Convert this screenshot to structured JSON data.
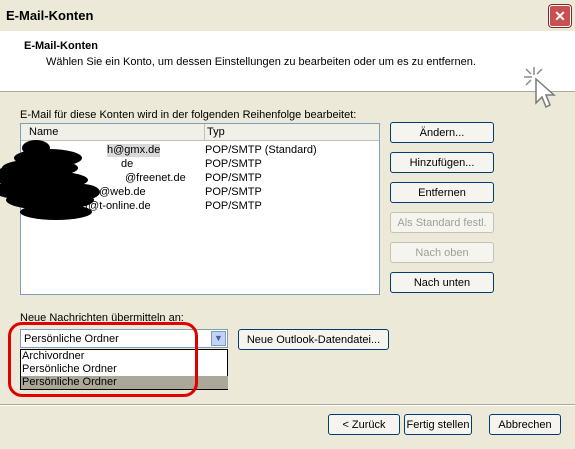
{
  "window": {
    "title": "E-Mail-Konten",
    "close_label": "✕"
  },
  "header": {
    "title": "E-Mail-Konten",
    "subtitle": "Wählen Sie ein Konto, um dessen Einstellungen zu bearbeiten oder um es zu entfernen."
  },
  "list_label": "E-Mail für diese Konten wird in der folgenden Reihenfolge bearbeitet:",
  "columns": {
    "name": "Name",
    "type": "Typ"
  },
  "accounts": [
    {
      "name": "h@gmx.de",
      "type": "POP/SMTP (Standard)"
    },
    {
      "name": "de",
      "type": "POP/SMTP"
    },
    {
      "name": "@freenet.de",
      "type": "POP/SMTP"
    },
    {
      "name": "@web.de",
      "type": "POP/SMTP"
    },
    {
      "name": "t@t-online.de",
      "type": "POP/SMTP"
    }
  ],
  "buttons": {
    "change": "Ändern...",
    "add": "Hinzufügen...",
    "remove": "Entfernen",
    "set_default": "Als Standard festl.",
    "move_up": "Nach oben",
    "move_down": "Nach unten",
    "new_data_file": "Neue Outlook-Datendatei...",
    "back": "< Zurück",
    "finish": "Fertig stellen",
    "cancel": "Abbrechen"
  },
  "delivery": {
    "label": "Neue Nachrichten übermitteln an:",
    "selected": "Persönliche Ordner",
    "options": [
      "Archivordner",
      "Persönliche Ordner",
      "Persönliche Ordner"
    ]
  },
  "colors": {
    "highlight": "#e10000",
    "dialog_bg": "#ece9d8"
  }
}
